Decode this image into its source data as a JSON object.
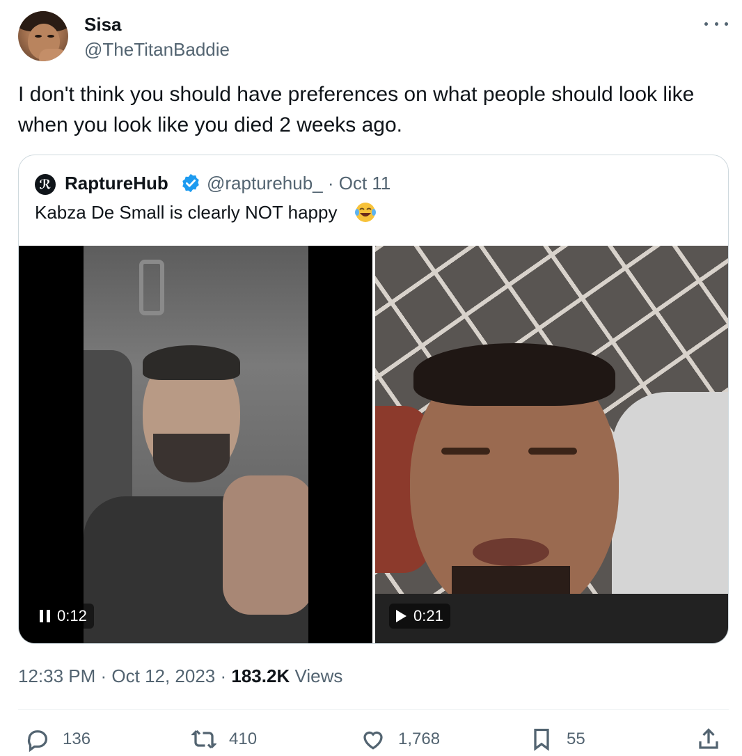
{
  "author": {
    "name": "Sisa",
    "handle": "@TheTitanBaddie"
  },
  "tweet_text": "I don't think you should have preferences on what people should look like when you look like you died 2 weeks ago.",
  "quote": {
    "name": "RaptureHub",
    "verified": true,
    "handle_date": "@rapturehub_ · Oct 11",
    "text": "Kabza De Small is clearly NOT happy",
    "emoji": "face-with-tears-of-joy",
    "videos": [
      {
        "state": "playing",
        "time": "0:12"
      },
      {
        "state": "paused",
        "time": "0:21"
      }
    ]
  },
  "meta": {
    "timestamp": "12:33 PM · Oct 12, 2023 · ",
    "views_count": "183.2K",
    "views_label": " Views"
  },
  "actions": {
    "replies": "136",
    "retweets": "410",
    "likes": "1,768",
    "bookmarks": "55"
  },
  "colors": {
    "text": "#0f1419",
    "secondary": "#536471",
    "verified": "#1d9bf0",
    "border": "#cfd9de"
  }
}
